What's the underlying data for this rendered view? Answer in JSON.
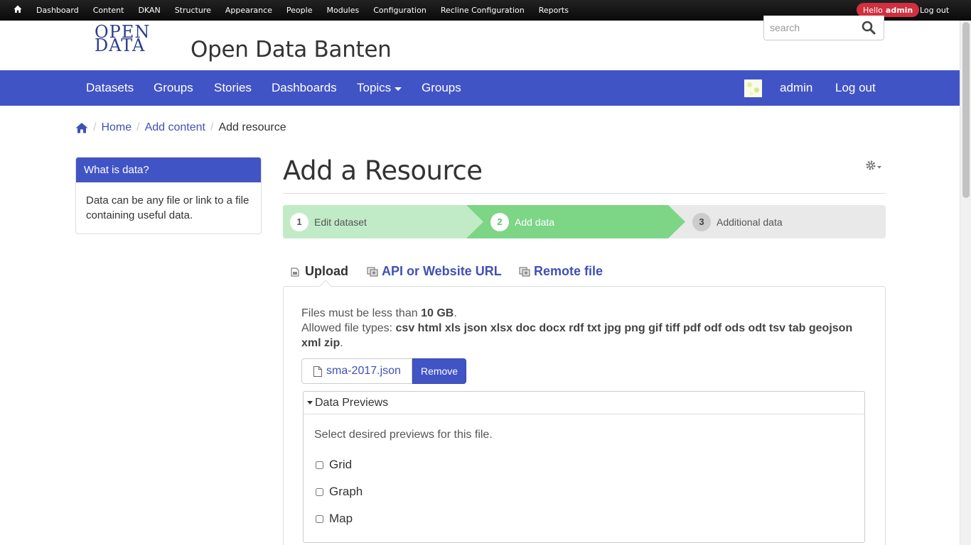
{
  "admin_toolbar": {
    "menu": [
      "Dashboard",
      "Content",
      "DKAN",
      "Structure",
      "Appearance",
      "People",
      "Modules",
      "Configuration",
      "Recline Configuration",
      "Reports"
    ],
    "hello_prefix": "Hello",
    "hello_user": "admin",
    "logout": "Log out"
  },
  "header": {
    "logo_line1": "OPEN",
    "logo_line2": "DATA",
    "site_name": "Open Data Banten",
    "search_placeholder": "search"
  },
  "main_nav": {
    "items": [
      "Datasets",
      "Groups",
      "Stories",
      "Dashboards",
      "Topics",
      "Groups"
    ],
    "user": "admin",
    "logout": "Log out"
  },
  "breadcrumb": {
    "items": [
      "Home",
      "Add content"
    ],
    "current": "Add resource"
  },
  "sidebar": {
    "title": "What is data?",
    "body": "Data can be any file or link to a file containing useful data."
  },
  "page": {
    "title": "Add a Resource"
  },
  "stepper": {
    "steps": [
      {
        "num": "1",
        "label": "Edit dataset"
      },
      {
        "num": "2",
        "label": "Add data"
      },
      {
        "num": "3",
        "label": "Additional data"
      }
    ],
    "colors": {
      "done": "#c1ebc6",
      "active": "#7dd586",
      "todo": "#e9e9e9"
    }
  },
  "tabs": [
    "Upload",
    "API or Website URL",
    "Remote file"
  ],
  "upload": {
    "size_prefix": "Files must be less than",
    "size_value": "10 GB",
    "size_suffix": ".",
    "types_prefix": "Allowed file types:",
    "types_value": "csv html xls json xlsx doc docx rdf txt jpg png gif tiff pdf odf ods odt tsv tab geojson xml zip",
    "types_suffix": ".",
    "file_name": "sma-2017.json",
    "remove": "Remove"
  },
  "previews": {
    "legend": "Data Previews",
    "desc": "Select desired previews for this file.",
    "options": [
      "Grid",
      "Graph",
      "Map"
    ]
  },
  "colors": {
    "brand": "#4154c5",
    "link": "#3f51b5",
    "admin_bar": "#101010",
    "hello_badge": "#d03040"
  }
}
